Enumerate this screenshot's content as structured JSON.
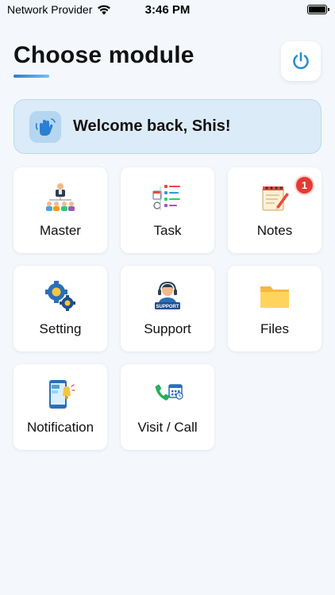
{
  "status_bar": {
    "carrier": "Network Provider",
    "time": "3:46 PM"
  },
  "header": {
    "title": "Choose module"
  },
  "welcome": {
    "text": "Welcome back, Shis!"
  },
  "modules": [
    {
      "label": "Master",
      "icon": "team-hierarchy-icon"
    },
    {
      "label": "Task",
      "icon": "task-list-icon"
    },
    {
      "label": "Notes",
      "icon": "notepad-icon",
      "badge": "1"
    },
    {
      "label": "Setting",
      "icon": "gears-icon"
    },
    {
      "label": "Support",
      "icon": "support-agent-icon"
    },
    {
      "label": "Files",
      "icon": "folder-icon"
    },
    {
      "label": "Notification",
      "icon": "phone-notification-icon"
    },
    {
      "label": "Visit / Call",
      "icon": "phone-calendar-icon"
    }
  ],
  "colors": {
    "background": "#f4f8fc",
    "accent": "#2a8fcb",
    "badge": "#e53935"
  }
}
